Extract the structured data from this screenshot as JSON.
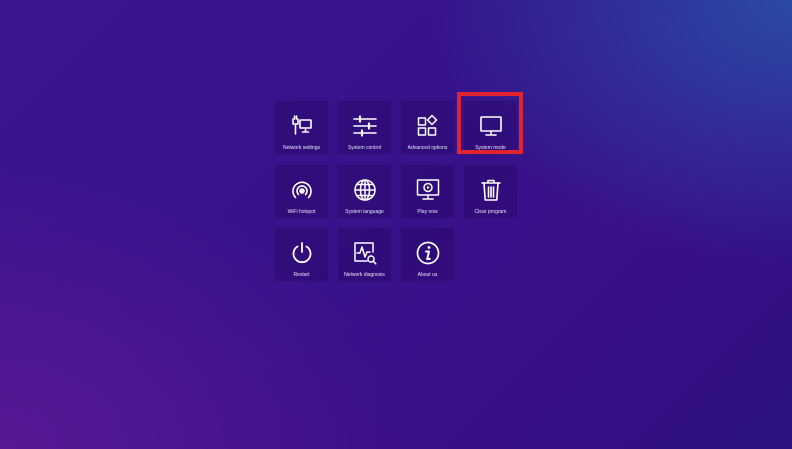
{
  "tiles": [
    {
      "label": "Network settings",
      "icon": "network-settings-icon"
    },
    {
      "label": "System control",
      "icon": "sliders-icon"
    },
    {
      "label": "Advanced options",
      "icon": "advanced-options-icon"
    },
    {
      "label": "System mode",
      "icon": "monitor-icon"
    },
    {
      "label": "WiFi hotspot",
      "icon": "wifi-hotspot-icon"
    },
    {
      "label": "System language",
      "icon": "globe-icon"
    },
    {
      "label": "Play now",
      "icon": "play-screen-icon"
    },
    {
      "label": "Clear program",
      "icon": "trash-icon"
    },
    {
      "label": "Restart",
      "icon": "power-icon"
    },
    {
      "label": "Network diagnosis",
      "icon": "network-diagnosis-icon"
    },
    {
      "label": "About us",
      "icon": "info-icon"
    }
  ],
  "highlight": {
    "target": "System mode",
    "color": "#e0242d"
  }
}
